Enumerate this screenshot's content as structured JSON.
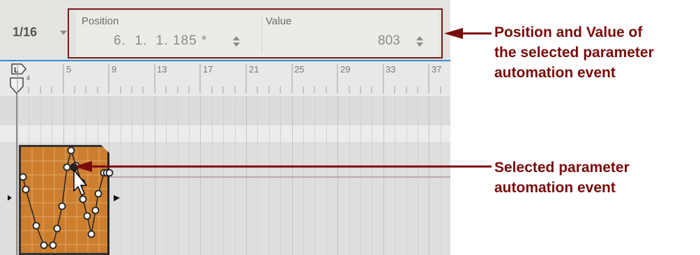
{
  "toolbar": {
    "snap_value": "1/16",
    "position_label": "Position",
    "position_value": "6.  1.  1. 185 *",
    "value_label": "Value",
    "value_value": "803"
  },
  "ruler": {
    "locator_label": "L",
    "locator_sub": "4",
    "bars": [
      "5",
      "9",
      "13",
      "17",
      "21",
      "25",
      "29",
      "33",
      "37"
    ]
  },
  "annotations": {
    "top_callout_lines": [
      "Position and Value of",
      "the selected parameter",
      "automation event"
    ],
    "bottom_callout_lines": [
      "Selected parameter",
      "automation event"
    ],
    "color": "#7a0b0b"
  },
  "clip": {
    "color": "#cc7e2e"
  }
}
